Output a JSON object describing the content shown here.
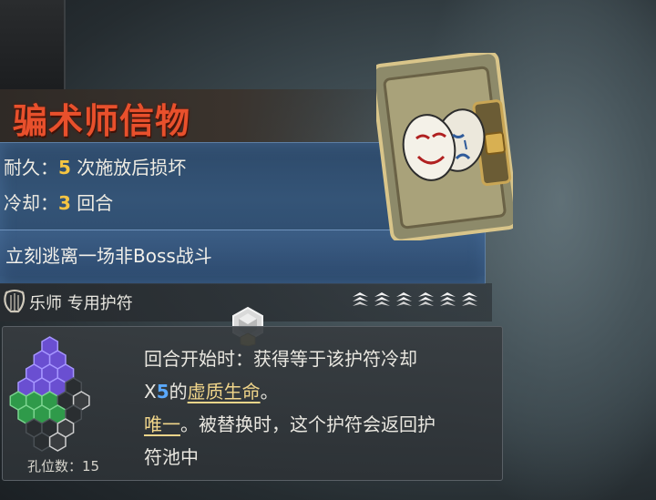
{
  "item": {
    "name": "骗术师信物",
    "durability_label": "耐久：",
    "durability_value": "5",
    "durability_suffix": " 次施放后损坏",
    "cooldown_label": "冷却：",
    "cooldown_value": "3",
    "cooldown_suffix": " 回合",
    "effect": "立刻逃离一场非Boss战斗",
    "class_label": "乐师 专用护符",
    "rank_count": 6
  },
  "passive": {
    "line1": "回合开始时：获得等于该护符冷却",
    "line2_prefix": "X",
    "line2_mult": "5",
    "line2_mid": "的",
    "line2_key": "虚质生命",
    "line2_end": "。",
    "line3_key": "唯一",
    "line3_rest": "。被替换时，这个护符会返回护",
    "line4": "符池中"
  },
  "slots": {
    "label": "孔位数：",
    "value": "15"
  },
  "colors": {
    "title": "#e8502c",
    "stat_number": "#f5c542",
    "highlight_blue": "#5aa9ff",
    "panel_blue": "#345477",
    "hex_purple": "#6a4fd1",
    "hex_green": "#2f9a4a"
  },
  "icons": {
    "class": "lyre-icon",
    "rank": "rank-chevron-icon",
    "socket": "gem-socket-icon",
    "card": "theater-masks-card"
  }
}
